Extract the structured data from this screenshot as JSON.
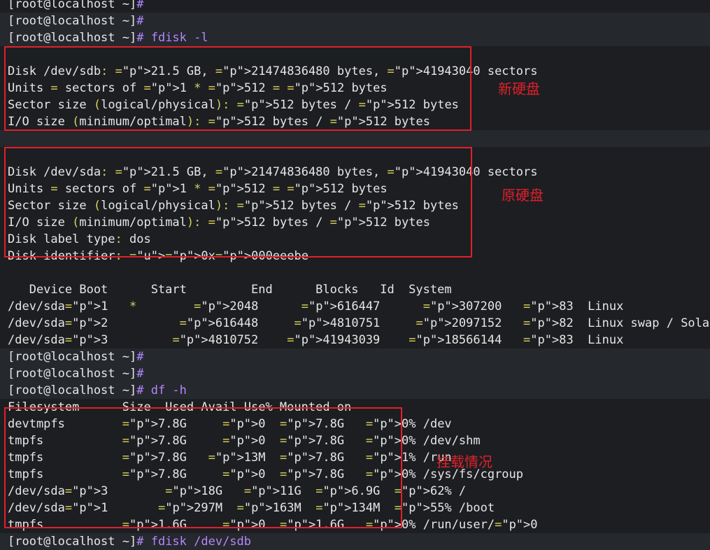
{
  "terminal": {
    "lines": [
      {
        "text": "[root@localhost ~]#",
        "hl": false
      },
      {
        "text": "[root@localhost ~]#",
        "hl": true
      },
      {
        "text": "[root@localhost ~]# fdisk -l",
        "hl": true
      },
      {
        "text": "",
        "hl": false
      },
      {
        "text": "Disk /dev/sdb: 21.5 GB, 21474836480 bytes, 41943040 sectors",
        "hl": false
      },
      {
        "text": "Units = sectors of 1 * 512 = 512 bytes",
        "hl": false
      },
      {
        "text": "Sector size (logical/physical): 512 bytes / 512 bytes",
        "hl": false
      },
      {
        "text": "I/O size (minimum/optimal): 512 bytes / 512 bytes",
        "hl": false
      },
      {
        "text": "",
        "hl": true
      },
      {
        "text": "",
        "hl": false
      },
      {
        "text": "Disk /dev/sda: 21.5 GB, 21474836480 bytes, 41943040 sectors",
        "hl": false
      },
      {
        "text": "Units = sectors of 1 * 512 = 512 bytes",
        "hl": false
      },
      {
        "text": "Sector size (logical/physical): 512 bytes / 512 bytes",
        "hl": false
      },
      {
        "text": "I/O size (minimum/optimal): 512 bytes / 512 bytes",
        "hl": false
      },
      {
        "text": "Disk label type: dos",
        "hl": false
      },
      {
        "text": "Disk identifier: 0x000eeebe",
        "hl": false
      },
      {
        "text": "",
        "hl": false
      },
      {
        "text": "   Device Boot      Start         End      Blocks   Id  System",
        "hl": false
      },
      {
        "text": "/dev/sda1   *        2048      616447      307200   83  Linux",
        "hl": false
      },
      {
        "text": "/dev/sda2          616448     4810751     2097152   82  Linux swap / Solaris",
        "hl": false
      },
      {
        "text": "/dev/sda3         4810752    41943039    18566144   83  Linux",
        "hl": false
      },
      {
        "text": "[root@localhost ~]#",
        "hl": true
      },
      {
        "text": "[root@localhost ~]#",
        "hl": true
      },
      {
        "text": "[root@localhost ~]# df -h",
        "hl": true
      },
      {
        "text": "Filesystem      Size  Used Avail Use% Mounted on",
        "hl": false
      },
      {
        "text": "devtmpfs        7.8G     0  7.8G   0% /dev",
        "hl": false
      },
      {
        "text": "tmpfs           7.8G     0  7.8G   0% /dev/shm",
        "hl": false
      },
      {
        "text": "tmpfs           7.8G   13M  7.8G   1% /run",
        "hl": false
      },
      {
        "text": "tmpfs           7.8G     0  7.8G   0% /sys/fs/cgroup",
        "hl": false
      },
      {
        "text": "/dev/sda3        18G   11G  6.9G  62% /",
        "hl": false
      },
      {
        "text": "/dev/sda1       297M  163M  134M  55% /boot",
        "hl": false
      },
      {
        "text": "tmpfs           1.6G     0  1.6G   0% /run/user/0",
        "hl": false
      },
      {
        "text": "[root@localhost ~]# fdisk /dev/sdb",
        "hl": true
      }
    ]
  },
  "annotations": [
    {
      "id": "new-disk",
      "text": "新硬盘"
    },
    {
      "id": "old-disk",
      "text": "原硬盘"
    },
    {
      "id": "mounts",
      "text": "挂载情况"
    }
  ],
  "colors": {
    "background": "#1c1e22",
    "prompt_line_highlight": "#25282d",
    "text": "#e6e6e6",
    "number": "#b486ff",
    "punctuation": "#d8d15c",
    "annotation": "#e0202a"
  }
}
